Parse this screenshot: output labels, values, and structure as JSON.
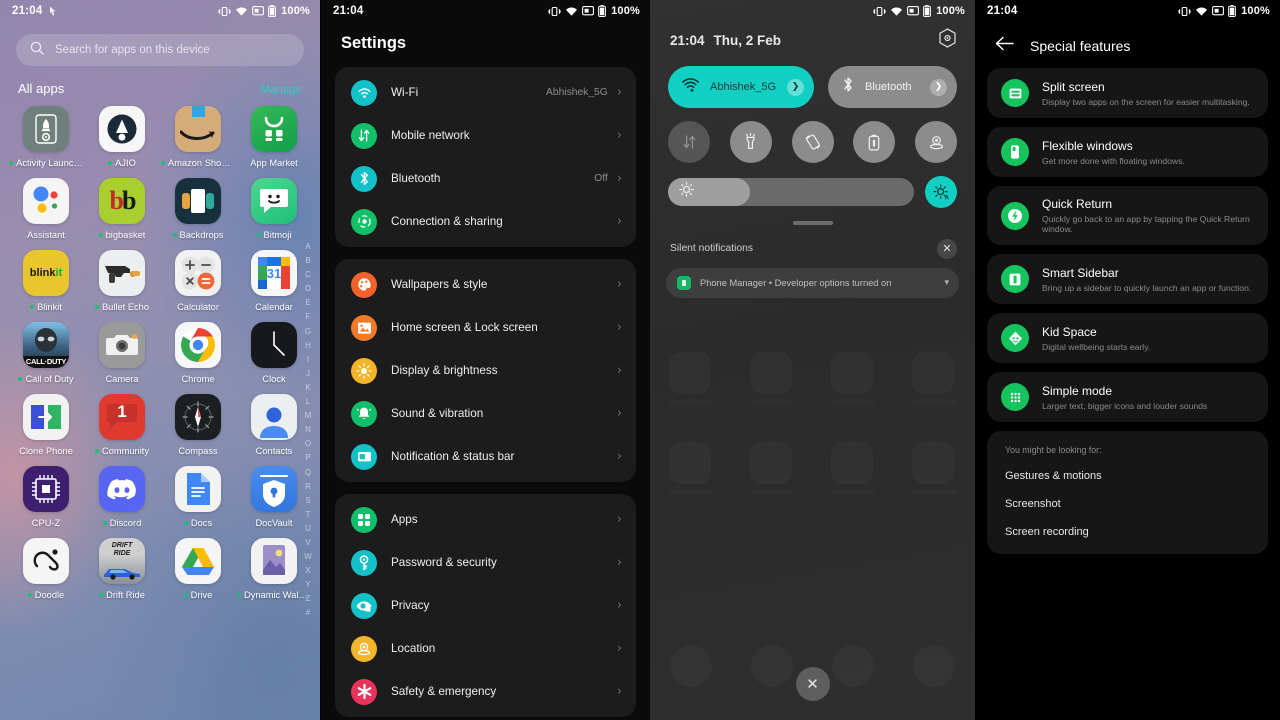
{
  "statusbar": {
    "time": "21:04",
    "battery": "100%",
    "icons": [
      "vibrate-icon",
      "wifi-icon",
      "screen-cast-icon",
      "battery-icon"
    ]
  },
  "panel1": {
    "name": "app-drawer",
    "search": {
      "placeholder": "Search for apps on this device",
      "icon": "search-icon"
    },
    "section_title": "All apps",
    "manage_label": "Manage",
    "manage_color": "#2ad0c4",
    "left_status_icon": "touch-pointer-icon",
    "az_index": [
      "A",
      "B",
      "C",
      "D",
      "E",
      "F",
      "G",
      "H",
      "I",
      "J",
      "K",
      "L",
      "M",
      "N",
      "O",
      "P",
      "Q",
      "R",
      "S",
      "T",
      "U",
      "V",
      "W",
      "X",
      "Y",
      "Z",
      "#"
    ],
    "apps": [
      {
        "label": "Activity Launc…",
        "new": true,
        "icon": "activity-launcher-icon"
      },
      {
        "label": "AJIO",
        "new": true,
        "icon": "ajio-icon"
      },
      {
        "label": "Amazon Shop…",
        "new": true,
        "icon": "amazon-shopping-icon"
      },
      {
        "label": "App Market",
        "new": false,
        "icon": "app-market-icon"
      },
      {
        "label": "Assistant",
        "new": false,
        "icon": "google-assistant-icon"
      },
      {
        "label": "bigbasket",
        "new": true,
        "icon": "bigbasket-icon"
      },
      {
        "label": "Backdrops",
        "new": true,
        "icon": "backdrops-icon"
      },
      {
        "label": "Bitmoji",
        "new": true,
        "icon": "bitmoji-icon"
      },
      {
        "label": "Blinkit",
        "new": true,
        "icon": "blinkit-icon"
      },
      {
        "label": "Bullet Echo",
        "new": true,
        "icon": "bullet-echo-icon"
      },
      {
        "label": "Calculator",
        "new": false,
        "icon": "calculator-icon"
      },
      {
        "label": "Calendar",
        "new": false,
        "icon": "calendar-icon"
      },
      {
        "label": "Call of Duty",
        "new": true,
        "icon": "call-of-duty-icon"
      },
      {
        "label": "Camera",
        "new": false,
        "icon": "camera-icon"
      },
      {
        "label": "Chrome",
        "new": false,
        "icon": "chrome-icon"
      },
      {
        "label": "Clock",
        "new": false,
        "icon": "clock-icon"
      },
      {
        "label": "Clone Phone",
        "new": false,
        "icon": "clone-phone-icon"
      },
      {
        "label": "Community",
        "new": true,
        "icon": "community-icon"
      },
      {
        "label": "Compass",
        "new": false,
        "icon": "compass-icon"
      },
      {
        "label": "Contacts",
        "new": false,
        "icon": "contacts-icon"
      },
      {
        "label": "CPU-Z",
        "new": false,
        "icon": "cpu-z-icon"
      },
      {
        "label": "Discord",
        "new": true,
        "icon": "discord-icon"
      },
      {
        "label": "Docs",
        "new": true,
        "icon": "google-docs-icon"
      },
      {
        "label": "DocVault",
        "new": false,
        "icon": "docvault-icon"
      },
      {
        "label": "Doodle",
        "new": true,
        "icon": "doodle-icon"
      },
      {
        "label": "Drift Ride",
        "new": true,
        "icon": "drift-ride-icon"
      },
      {
        "label": "Drive",
        "new": true,
        "icon": "google-drive-icon"
      },
      {
        "label": "Dynamic Walp…",
        "new": true,
        "icon": "dynamic-wallpaper-icon"
      }
    ]
  },
  "panel2": {
    "name": "settings-app",
    "title": "Settings",
    "groups": [
      {
        "rows": [
          {
            "label": "Wi-Fi",
            "value": "Abhishek_5G",
            "icon": "wifi-icon",
            "color": "#12c2c8"
          },
          {
            "label": "Mobile network",
            "value": "",
            "icon": "mobile-network-icon",
            "color": "#13c06a"
          },
          {
            "label": "Bluetooth",
            "value": "Off",
            "icon": "bluetooth-icon",
            "color": "#12c2c8"
          },
          {
            "label": "Connection & sharing",
            "value": "",
            "icon": "connection-sharing-icon",
            "color": "#13c06a"
          }
        ]
      },
      {
        "rows": [
          {
            "label": "Wallpapers & style",
            "value": "",
            "icon": "palette-icon",
            "color": "#f2622b"
          },
          {
            "label": "Home screen & Lock screen",
            "value": "",
            "icon": "home-lock-screen-icon",
            "color": "#f07a2b"
          },
          {
            "label": "Display & brightness",
            "value": "",
            "icon": "brightness-icon",
            "color": "#f3b62b"
          },
          {
            "label": "Sound & vibration",
            "value": "",
            "icon": "sound-vibration-icon",
            "color": "#13c06a"
          },
          {
            "label": "Notification & status bar",
            "value": "",
            "icon": "notification-statusbar-icon",
            "color": "#12c2c8"
          }
        ]
      },
      {
        "rows": [
          {
            "label": "Apps",
            "value": "",
            "icon": "apps-grid-icon",
            "color": "#13c06a"
          },
          {
            "label": "Password & security",
            "value": "",
            "icon": "key-icon",
            "color": "#12c2c8"
          },
          {
            "label": "Privacy",
            "value": "",
            "icon": "privacy-icon",
            "color": "#12c2c8"
          },
          {
            "label": "Location",
            "value": "",
            "icon": "location-pin-icon",
            "color": "#f3b62b"
          },
          {
            "label": "Safety & emergency",
            "value": "",
            "icon": "safety-emergency-icon",
            "color": "#e8345a"
          }
        ]
      }
    ]
  },
  "panel3": {
    "name": "quick-settings-shade",
    "time": "21:04",
    "date": "Thu, 2 Feb",
    "settings_gear_icon": "hex-gear-icon",
    "tiles_large": [
      {
        "label": "Abhishek_5G",
        "icon": "wifi-icon",
        "state": "on"
      },
      {
        "label": "Bluetooth",
        "icon": "bluetooth-icon",
        "state": "off"
      }
    ],
    "tiles_small": [
      {
        "icon": "mobile-data-icon",
        "state": "disabled"
      },
      {
        "icon": "flashlight-icon",
        "state": "off"
      },
      {
        "icon": "auto-rotate-icon",
        "state": "off"
      },
      {
        "icon": "battery-saver-icon",
        "state": "off"
      },
      {
        "icon": "location-icon",
        "state": "off"
      }
    ],
    "brightness": {
      "icon": "brightness-icon",
      "auto_icon": "brightness-auto-icon",
      "level_percent": 26
    },
    "notifications": {
      "section_label": "Silent notifications",
      "close_icon": "close-icon",
      "items": [
        {
          "app": "Phone Manager",
          "text": "Phone Manager • Developer options turned on",
          "expand_icon": "chevron-down-icon",
          "icon": "phone-manager-icon"
        }
      ]
    },
    "close_button_icon": "close-icon"
  },
  "panel4": {
    "name": "special-features-settings",
    "back_icon": "arrow-left-icon",
    "title": "Special features",
    "features": [
      {
        "name": "Split screen",
        "desc": "Display two apps on the screen for easier multitasking.",
        "icon": "split-screen-icon"
      },
      {
        "name": "Flexible windows",
        "desc": "Get more done with floating windows.",
        "icon": "flexible-windows-icon"
      },
      {
        "name": "Quick Return",
        "desc": "Quickly go back to an app by tapping the Quick Return window.",
        "icon": "quick-return-icon"
      },
      {
        "name": "Smart Sidebar",
        "desc": "Bring up a sidebar to quickly launch an app or function.",
        "icon": "smart-sidebar-icon"
      },
      {
        "name": "Kid Space",
        "desc": "Digital wellbeing starts early.",
        "icon": "kid-space-icon"
      },
      {
        "name": "Simple mode",
        "desc": "Larger text, bigger icons and louder sounds",
        "icon": "simple-mode-icon"
      }
    ],
    "looking_for": {
      "header": "You might be looking for:",
      "items": [
        "Gestures & motions",
        "Screenshot",
        "Screen recording"
      ]
    }
  }
}
